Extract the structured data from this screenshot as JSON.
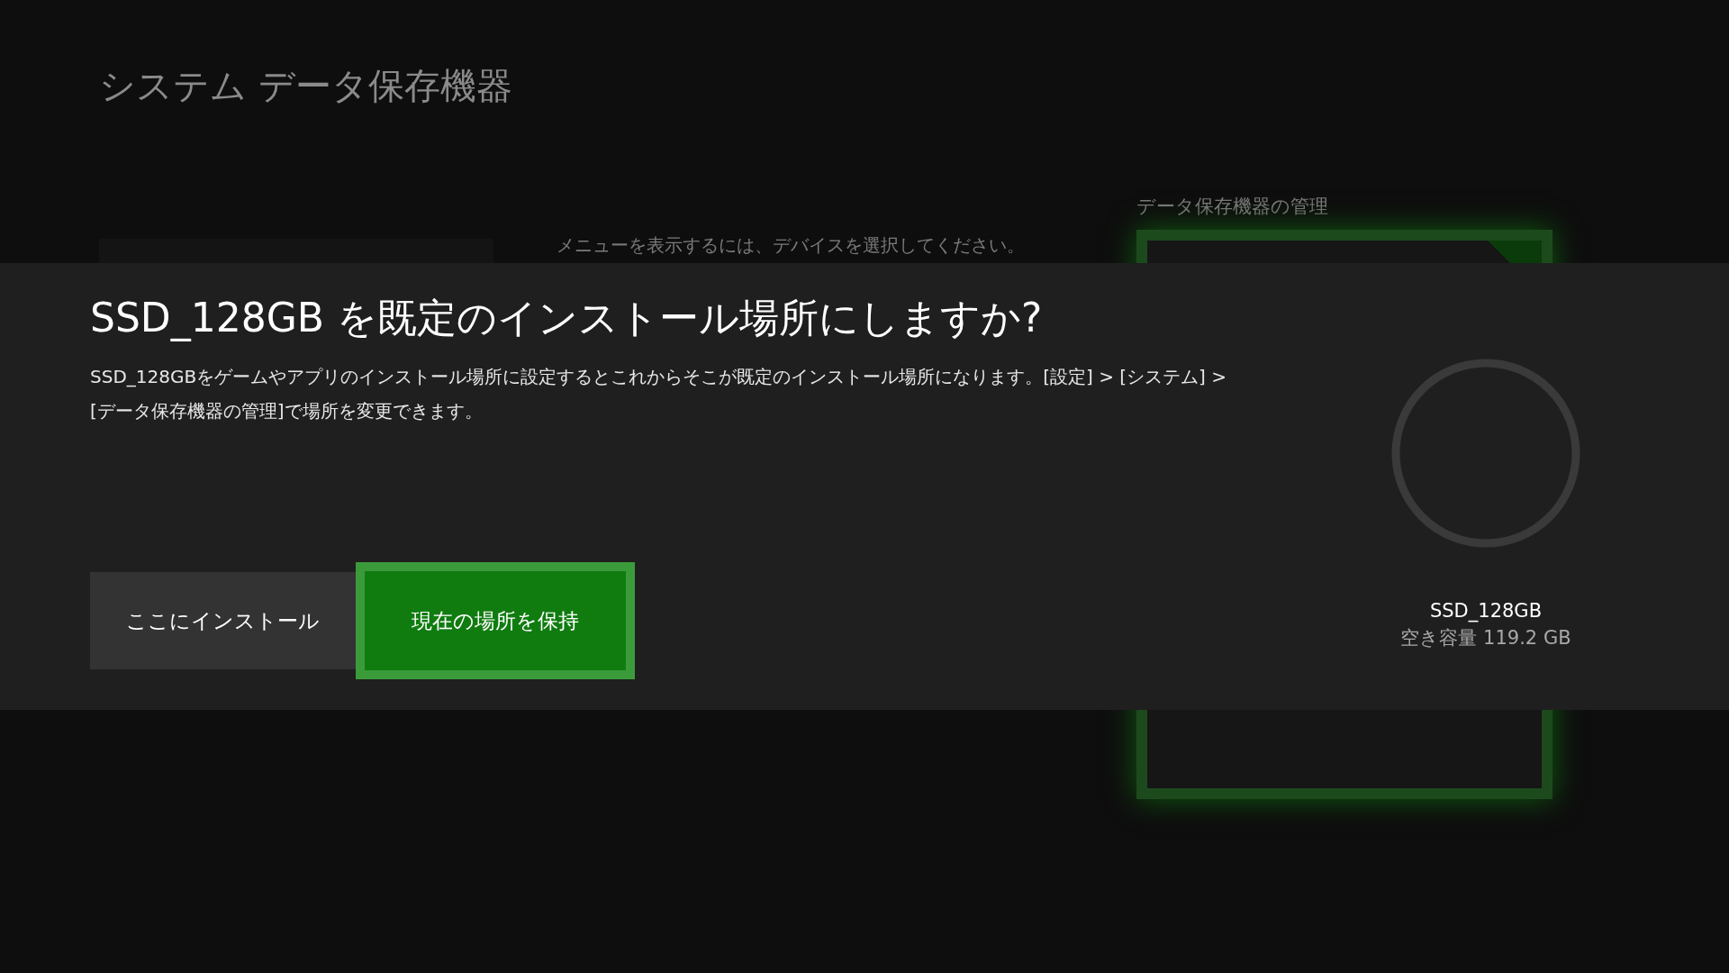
{
  "page": {
    "title": "システム データ保存機器",
    "hint": "メニューを表示するには、デバイスを選択してください。",
    "manage_label": "データ保存機器の管理"
  },
  "dialog": {
    "title": "SSD_128GB を既定のインストール場所にしますか?",
    "body": "SSD_128GBをゲームやアプリのインストール場所に設定するとこれからそこが既定のインストール場所になります。[設定] > [システム] > [データ保存機器の管理]で場所を変更できます。",
    "buttons": [
      {
        "label": "ここにインストール",
        "focused": false
      },
      {
        "label": "現在の場所を保持",
        "focused": true
      }
    ],
    "device": {
      "name": "SSD_128GB",
      "free_space": "空き容量 119.2 GB"
    }
  }
}
